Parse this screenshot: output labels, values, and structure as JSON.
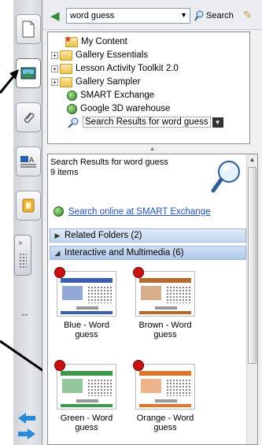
{
  "toolbar": {
    "search_value": "word guess",
    "search_button_label": "Search"
  },
  "tree": {
    "items": [
      {
        "label": "My Content",
        "icon": "my-content-folder-icon"
      },
      {
        "label": "Gallery Essentials",
        "icon": "folder-icon",
        "expander": "+"
      },
      {
        "label": "Lesson Activity Toolkit 2.0",
        "icon": "folder-icon",
        "expander": "+"
      },
      {
        "label": "Gallery Sampler",
        "icon": "folder-icon",
        "expander": "+"
      },
      {
        "label": "SMART Exchange",
        "icon": "globe-icon"
      },
      {
        "label": "Google 3D warehouse",
        "icon": "globe-icon"
      },
      {
        "label": "Search Results for word guess",
        "icon": "search-icon"
      }
    ]
  },
  "results": {
    "title": "Search Results for word guess",
    "count": "9 items",
    "online_link": "Search online at SMART Exchange",
    "sections": [
      {
        "label": "Related Folders (2)",
        "state": "collapsed"
      },
      {
        "label": "Interactive and Multimedia (6)",
        "state": "expanded"
      }
    ],
    "thumbnails": [
      {
        "label": "Blue - Word guess",
        "color": "#3a5fb0"
      },
      {
        "label": "Brown - Word guess",
        "color": "#b86a2e"
      },
      {
        "label": "Green - Word guess",
        "color": "#3d9a4a"
      },
      {
        "label": "Orange - Word guess",
        "color": "#e0752a"
      }
    ]
  },
  "colors": {
    "section_bar": "#c3d7ef",
    "link": "#1e4fb4",
    "badge": "#cc1111"
  }
}
